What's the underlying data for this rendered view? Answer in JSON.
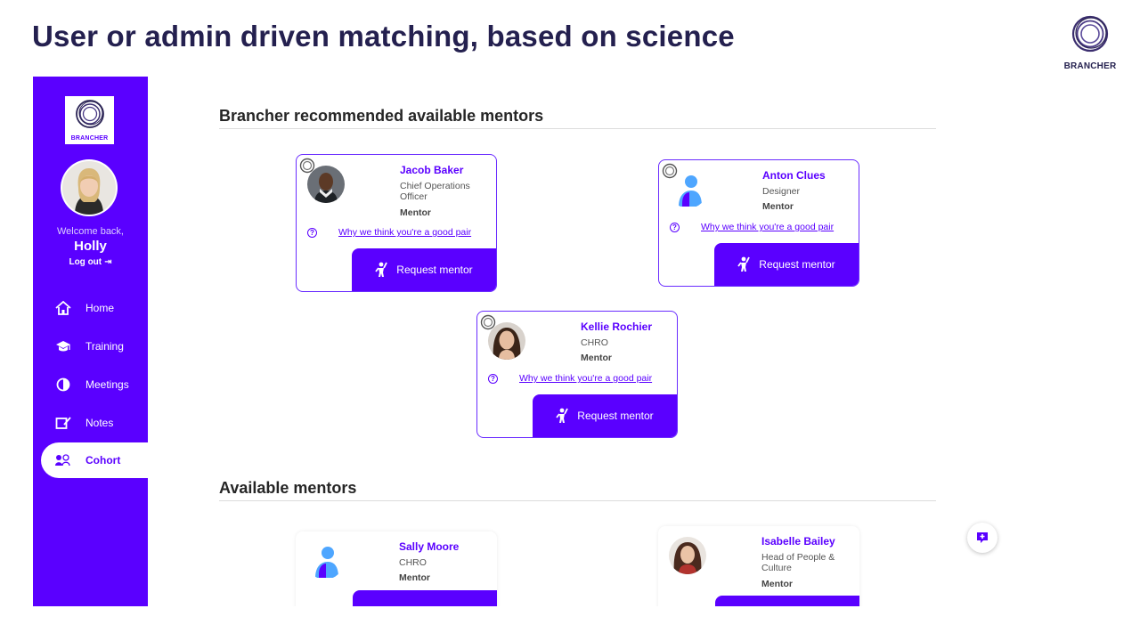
{
  "slide": {
    "title": "User or admin driven matching, based on science",
    "logo_text": "BRANCHER"
  },
  "sidebar": {
    "logo_text": "BRANCHER",
    "welcome": "Welcome back,",
    "user_name": "Holly",
    "logout": "Log out",
    "nav": [
      {
        "label": "Home",
        "icon": "home-icon"
      },
      {
        "label": "Training",
        "icon": "graduation-cap-icon"
      },
      {
        "label": "Meetings",
        "icon": "meetings-icon"
      },
      {
        "label": "Notes",
        "icon": "notes-icon"
      },
      {
        "label": "Cohort",
        "icon": "cohort-icon",
        "active": true
      }
    ]
  },
  "recommended": {
    "title": "Brancher recommended available mentors",
    "mentors": [
      {
        "name": "Jacob Baker",
        "role": "Chief Operations Officer",
        "type": "Mentor",
        "link": "Why we think you're a good pair",
        "button": "Request mentor"
      },
      {
        "name": "Anton Clues",
        "role": "Designer",
        "type": "Mentor",
        "link": "Why we think you're a good pair",
        "button": "Request mentor"
      },
      {
        "name": "Kellie Rochier",
        "role": "CHRO",
        "type": "Mentor",
        "link": "Why we think you're a good pair",
        "button": "Request mentor"
      }
    ]
  },
  "available": {
    "title": "Available mentors",
    "mentors": [
      {
        "name": "Sally Moore",
        "role": "CHRO",
        "type": "Mentor"
      },
      {
        "name": "Isabelle Bailey",
        "role": "Head of People & Culture",
        "type": "Mentor"
      }
    ]
  },
  "colors": {
    "brand": "#5a00ff",
    "title": "#24204f"
  }
}
